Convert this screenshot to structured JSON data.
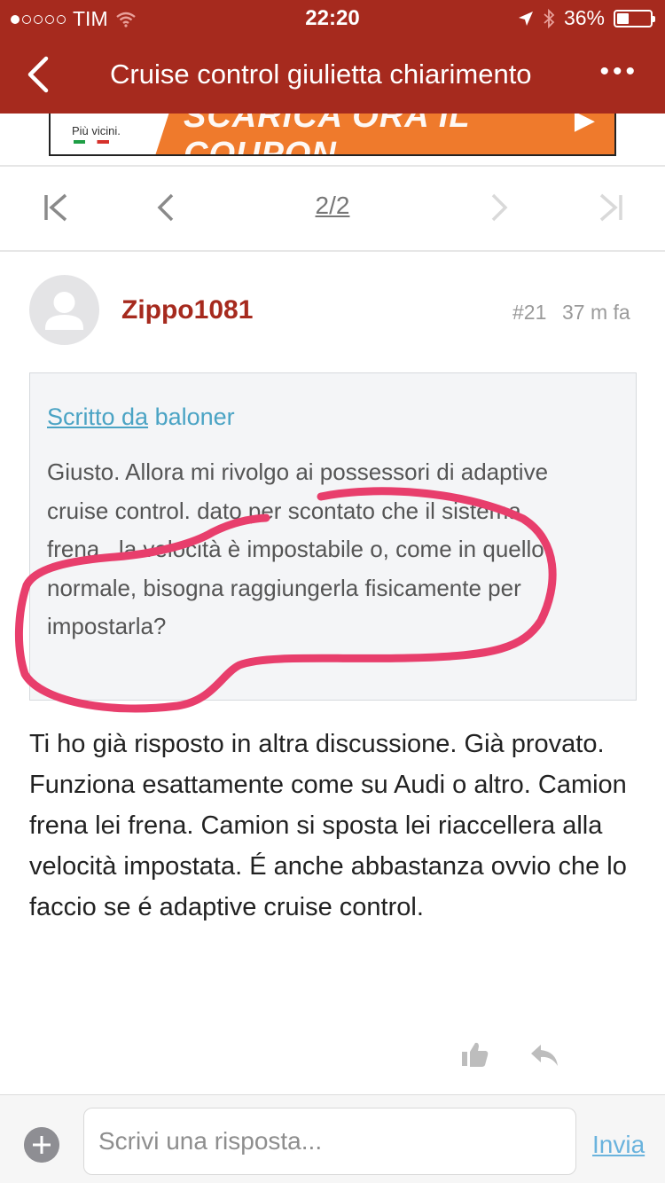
{
  "status_bar": {
    "carrier": "TIM",
    "time": "22:20",
    "battery": "36%",
    "battery_level": 0.36,
    "signal_dots_filled": 1,
    "signal_dots_total": 5
  },
  "nav": {
    "title": "Cruise control giulietta chiarimento",
    "more": "•••"
  },
  "ad": {
    "brand_tagline": "Più vicini.",
    "headline": "SCARICA ORA IL COUPON",
    "arrow": "▶"
  },
  "pagination": {
    "page": "2/2"
  },
  "post": {
    "username": "Zippo1081",
    "number": "#21",
    "time": "37 m fa",
    "quote": {
      "prefix": "Scritto da",
      "author": "baloner",
      "text": "Giusto. Allora mi rivolgo ai possessori di adaptive cruise control. dato per scontato che il sistema frena...la velocità è impostabile o, come in quello normale, bisogna raggiungerla fisicamente per impostarla?"
    },
    "body": "Ti ho già risposto in altra discussione. Già provato. Funziona esattamente come su Audi o altro. Camion frena lei frena. Camion si sposta lei riaccellera alla velocità impostata. É anche abbastanza ovvio che lo faccio se é adaptive cruise control."
  },
  "composer": {
    "placeholder": "Scrivi una risposta...",
    "send_label": "Invia"
  },
  "colors": {
    "brand_red": "#a62a1e",
    "link_blue": "#4aa3c4",
    "highlight_pink": "#e83e6c",
    "ad_orange": "#ef7a2c"
  },
  "icons": {
    "back": "chevron-left-icon",
    "first_page": "first-page-icon",
    "prev_page": "chevron-left-icon",
    "next_page": "chevron-right-icon",
    "last_page": "last-page-icon",
    "like": "thumbs-up-icon",
    "reply": "reply-icon",
    "add": "plus-icon"
  }
}
